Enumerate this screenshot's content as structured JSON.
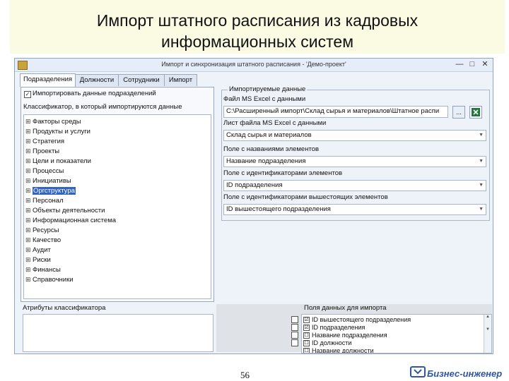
{
  "slide": {
    "title_line1": "Импорт штатного расписания из кадровых",
    "title_line2": "информационных систем",
    "page_number": "56",
    "logo_text": "Бизнес-инженер"
  },
  "window": {
    "title": "Импорт и синхронизация штатного расписания - 'Демо-проект'",
    "minimize": "—",
    "maximize": "□",
    "close": "✕"
  },
  "tabs": [
    "Подразделения",
    "Должности",
    "Сотрудники",
    "Импорт"
  ],
  "left_panel": {
    "import_checkbox_label": "Импортировать данные подразделений",
    "classifier_label": "Классификатор, в который импортируются данные",
    "tree_items": [
      "Факторы среды",
      "Продукты и услуги",
      "Стратегия",
      "Проекты",
      "Цели и показатели",
      "Процессы",
      "Инициативы",
      "Оргструктура",
      "Персонал",
      "Объекты деятельности",
      "Информационная система",
      "Ресурсы",
      "Качество",
      "Аудит",
      "Риски",
      "Финансы",
      "Справочники"
    ],
    "selected_item": "Оргструктура",
    "attributes_label": "Атрибуты классификатора"
  },
  "import_group": {
    "caption": "Импортируемые данные",
    "file_label": "Файл MS Excel с данными",
    "file_path": "C:\\Расширенный импорт\\Склад сырья и материалов\\Штатное распи",
    "browse_label": "...",
    "sheet_label": "Лист файла MS Excel с данными",
    "sheet_value": "Склад сырья и материалов",
    "names_label": "Поле с названиями элементов",
    "names_value": "Название подразделения",
    "ids_label": "Поле с идентификаторами элементов",
    "ids_value": "ID подразделения",
    "parent_ids_label": "Поле с идентификаторами вышестоящих элементов",
    "parent_ids_value": "ID вышестоящего подразделения"
  },
  "fields_panel": {
    "label": "Поля данных для импорта",
    "items": [
      {
        "name": "ID вышестоящего подразделения",
        "checked": "☑"
      },
      {
        "name": "ID подразделения",
        "checked": "☑"
      },
      {
        "name": "Название подразделения",
        "checked": "☐"
      },
      {
        "name": "ID должности",
        "checked": "☐"
      },
      {
        "name": "Название должности",
        "checked": "☐"
      }
    ]
  },
  "colors": {
    "accent": "#2f55a4",
    "selection": "#3264c8",
    "title_band": "#fbfbe3"
  }
}
